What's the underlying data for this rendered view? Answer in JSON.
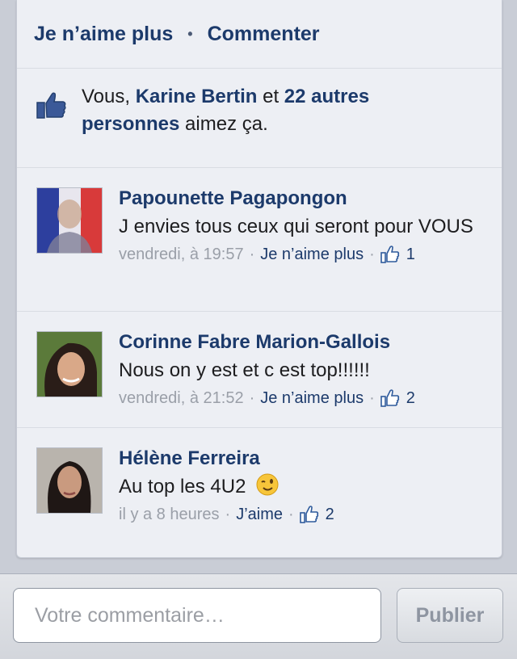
{
  "actions": {
    "unlike": "Je n’aime plus",
    "separator": "•",
    "comment": "Commenter"
  },
  "likes_summary": {
    "prefix": "Vous, ",
    "name": "Karine Bertin",
    "middle": " et ",
    "others": "22 autres personnes",
    "suffix": " aimez ça."
  },
  "comments": [
    {
      "author": "Papounette Pagapongon",
      "text": "J envies tous ceux qui seront pour VOUS",
      "time": "vendredi, à 19:57",
      "like_label": "Je n’aime plus",
      "likes": "1"
    },
    {
      "author": "Corinne Fabre Marion-Gallois",
      "text": "Nous on y est et c est top!!!!!!",
      "time": "vendredi, à 21:52",
      "like_label": "Je n’aime plus",
      "likes": "2"
    },
    {
      "author": "Hélène Ferreira",
      "text": "Au top les 4U2",
      "time": "il y a 8 heures",
      "like_label": "J’aime",
      "likes": "2"
    }
  ],
  "composer": {
    "placeholder": "Votre commentaire…",
    "publish": "Publier"
  },
  "colors": {
    "link": "#1c3a6b",
    "meta": "#9a9fa8",
    "background": "#edeff4"
  }
}
